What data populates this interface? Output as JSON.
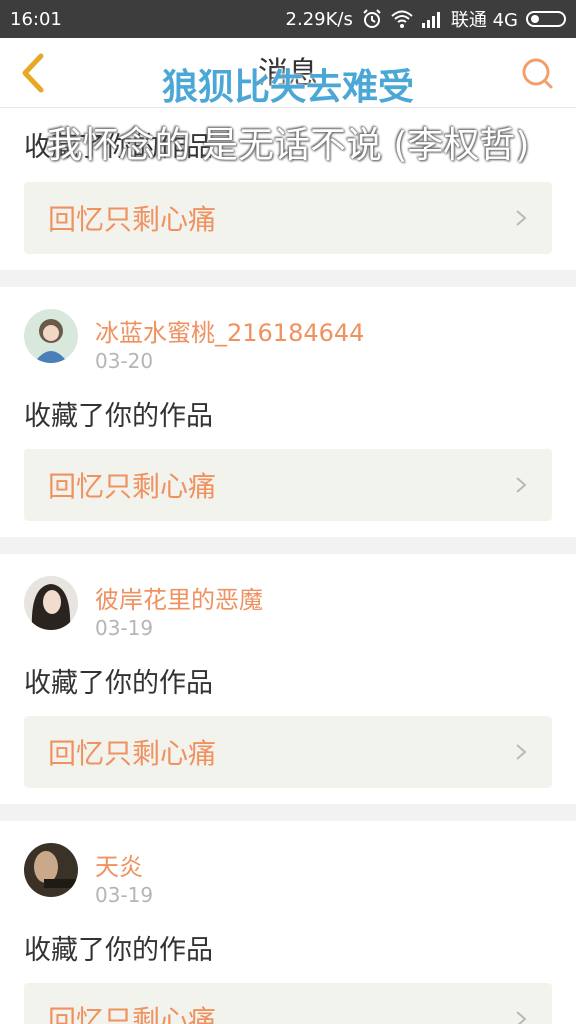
{
  "status_bar": {
    "time": "16:01",
    "speed": "2.29K/s",
    "carrier": "联通 4G"
  },
  "header": {
    "title": "消息"
  },
  "lyrics": {
    "line1": "狼狈比失去难受",
    "line2": "我怀念的 是无话不说 (李权哲)"
  },
  "first_item": {
    "action": "收藏了你的作品",
    "work_title": "回忆只剩心痛"
  },
  "items": [
    {
      "user": "冰蓝水蜜桃_216184644",
      "date": "03-20",
      "action": "收藏了你的作品",
      "work_title": "回忆只剩心痛"
    },
    {
      "user": "彼岸花里的恶魔",
      "date": "03-19",
      "action": "收藏了你的作品",
      "work_title": "回忆只剩心痛"
    },
    {
      "user": "天炎",
      "date": "03-19",
      "action": "收藏了你的作品",
      "work_title": "回忆只剩心痛"
    }
  ],
  "colors": {
    "accent": "#f09160",
    "header_icon": "#e8a825",
    "search_icon": "#f0a070",
    "lyric_blue": "#4aa7d6"
  }
}
